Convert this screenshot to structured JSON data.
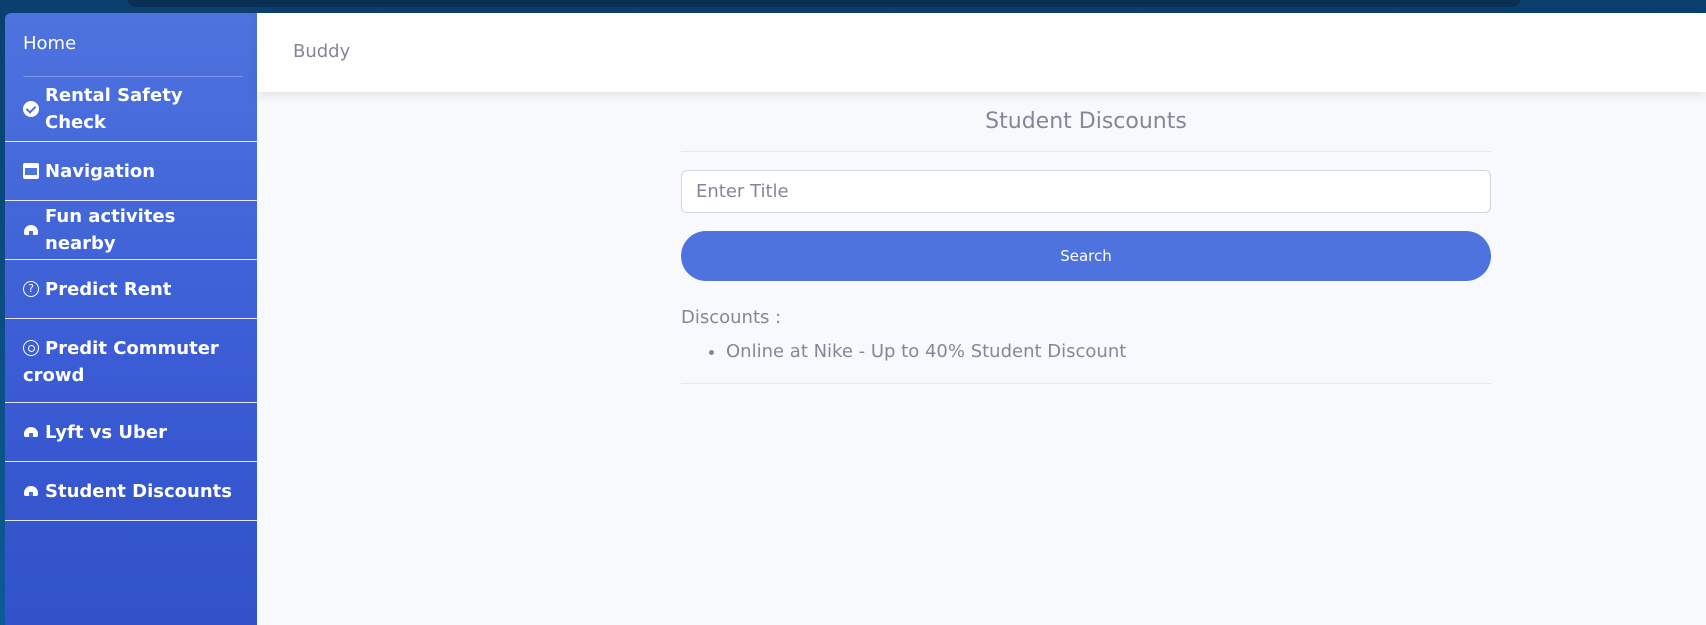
{
  "sidebar": {
    "home_label": "Home",
    "items": [
      {
        "label": "Rental Safety Check",
        "icon": "check-circle-icon"
      },
      {
        "label": "Navigation",
        "icon": "image-icon"
      },
      {
        "label": "Fun activites nearby",
        "icon": "dome-icon"
      },
      {
        "label": "Predict Rent",
        "icon": "question-circle-icon"
      },
      {
        "label": "Predit Commuter crowd",
        "icon": "target-icon"
      },
      {
        "label": "Lyft vs Uber",
        "icon": "dome-icon"
      },
      {
        "label": "Student Discounts",
        "icon": "dome-icon"
      }
    ]
  },
  "topbar": {
    "brand": "Buddy"
  },
  "main": {
    "title": "Student Discounts",
    "search": {
      "placeholder": "Enter Title",
      "value": ""
    },
    "search_button": "Search",
    "discounts_label": "Discounts :",
    "discounts": [
      "Online at Nike - Up to 40% Student Discount"
    ]
  },
  "colors": {
    "primary": "#4e73df",
    "text_muted": "#858796",
    "page_bg": "#f8f9fc"
  }
}
